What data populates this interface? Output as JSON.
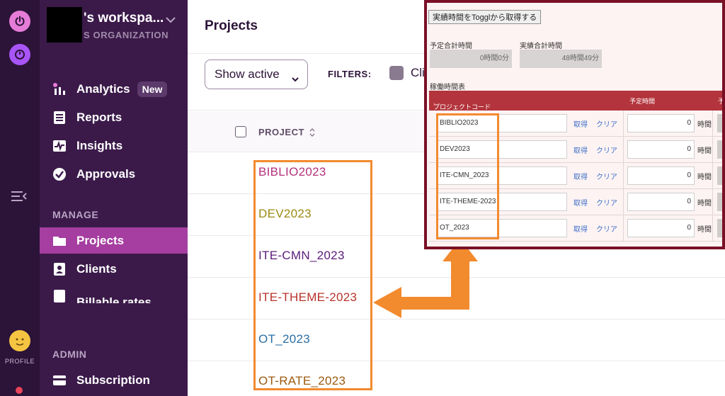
{
  "workspace": {
    "name": "'s workspa...",
    "org": "S ORGANIZATION"
  },
  "rail": {
    "profile_label": "PROFILE"
  },
  "nav": {
    "analytics": "Analytics",
    "analytics_badge": "New",
    "reports": "Reports",
    "insights": "Insights",
    "approvals": "Approvals",
    "manage_label": "MANAGE",
    "projects": "Projects",
    "clients": "Clients",
    "billable_rates": "Billable rates",
    "admin_label": "ADMIN",
    "subscription": "Subscription"
  },
  "main": {
    "title": "Projects",
    "show_active": "Show active",
    "filters_label": "FILTERS:",
    "client_filter": "Cli",
    "column_project": "PROJECT"
  },
  "projects": [
    {
      "name": "BIBLIO2023",
      "color": "#b4317b"
    },
    {
      "name": "DEV2023",
      "color": "#9b8a14"
    },
    {
      "name": "ITE-CMN_2023",
      "color": "#5b1b7a"
    },
    {
      "name": "ITE-THEME-2023",
      "color": "#b8332b"
    },
    {
      "name": "OT_2023",
      "color": "#2b6ea3"
    },
    {
      "name": "OT-RATE_2023",
      "color": "#9c5a0f"
    }
  ],
  "inset": {
    "fetch_button": "実績時間をTogglから取得する",
    "planned_total_label": "予定合計時間",
    "planned_total_value": "0時間0分",
    "actual_total_label": "実績合計時間",
    "actual_total_value": "48時間49分",
    "table_label": "稼働時間表",
    "col_project_code": "プロジェクトコード",
    "required_mark": "*",
    "col_planned_hours": "予定時間",
    "col_stub": "予",
    "fetch_link": "取得",
    "clear_link": "クリア",
    "hours_unit": "時間",
    "rows": [
      {
        "code": "BIBLIO2023",
        "hours": "0"
      },
      {
        "code": "DEV2023",
        "hours": "0"
      },
      {
        "code": "ITE-CMN_2023",
        "hours": "0"
      },
      {
        "code": "ITE-THEME-2023",
        "hours": "0"
      },
      {
        "code": "OT_2023",
        "hours": "0"
      }
    ]
  },
  "colors": {
    "rail_bg": "#2c1338",
    "sidebar_bg": "#3b1a4a",
    "active_item": "#a53ea0",
    "annotation": "#f28a2e",
    "inset_border": "#7a1026",
    "inset_header": "#b3343c"
  }
}
